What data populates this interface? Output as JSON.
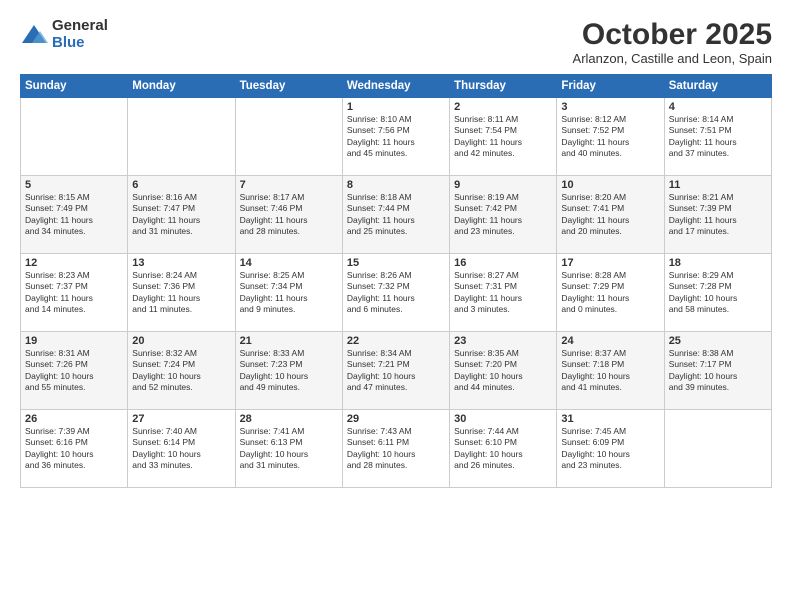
{
  "logo": {
    "general": "General",
    "blue": "Blue"
  },
  "header": {
    "month": "October 2025",
    "location": "Arlanzon, Castille and Leon, Spain"
  },
  "weekdays": [
    "Sunday",
    "Monday",
    "Tuesday",
    "Wednesday",
    "Thursday",
    "Friday",
    "Saturday"
  ],
  "weeks": [
    [
      {
        "day": "",
        "info": ""
      },
      {
        "day": "",
        "info": ""
      },
      {
        "day": "",
        "info": ""
      },
      {
        "day": "1",
        "info": "Sunrise: 8:10 AM\nSunset: 7:56 PM\nDaylight: 11 hours\nand 45 minutes."
      },
      {
        "day": "2",
        "info": "Sunrise: 8:11 AM\nSunset: 7:54 PM\nDaylight: 11 hours\nand 42 minutes."
      },
      {
        "day": "3",
        "info": "Sunrise: 8:12 AM\nSunset: 7:52 PM\nDaylight: 11 hours\nand 40 minutes."
      },
      {
        "day": "4",
        "info": "Sunrise: 8:14 AM\nSunset: 7:51 PM\nDaylight: 11 hours\nand 37 minutes."
      }
    ],
    [
      {
        "day": "5",
        "info": "Sunrise: 8:15 AM\nSunset: 7:49 PM\nDaylight: 11 hours\nand 34 minutes."
      },
      {
        "day": "6",
        "info": "Sunrise: 8:16 AM\nSunset: 7:47 PM\nDaylight: 11 hours\nand 31 minutes."
      },
      {
        "day": "7",
        "info": "Sunrise: 8:17 AM\nSunset: 7:46 PM\nDaylight: 11 hours\nand 28 minutes."
      },
      {
        "day": "8",
        "info": "Sunrise: 8:18 AM\nSunset: 7:44 PM\nDaylight: 11 hours\nand 25 minutes."
      },
      {
        "day": "9",
        "info": "Sunrise: 8:19 AM\nSunset: 7:42 PM\nDaylight: 11 hours\nand 23 minutes."
      },
      {
        "day": "10",
        "info": "Sunrise: 8:20 AM\nSunset: 7:41 PM\nDaylight: 11 hours\nand 20 minutes."
      },
      {
        "day": "11",
        "info": "Sunrise: 8:21 AM\nSunset: 7:39 PM\nDaylight: 11 hours\nand 17 minutes."
      }
    ],
    [
      {
        "day": "12",
        "info": "Sunrise: 8:23 AM\nSunset: 7:37 PM\nDaylight: 11 hours\nand 14 minutes."
      },
      {
        "day": "13",
        "info": "Sunrise: 8:24 AM\nSunset: 7:36 PM\nDaylight: 11 hours\nand 11 minutes."
      },
      {
        "day": "14",
        "info": "Sunrise: 8:25 AM\nSunset: 7:34 PM\nDaylight: 11 hours\nand 9 minutes."
      },
      {
        "day": "15",
        "info": "Sunrise: 8:26 AM\nSunset: 7:32 PM\nDaylight: 11 hours\nand 6 minutes."
      },
      {
        "day": "16",
        "info": "Sunrise: 8:27 AM\nSunset: 7:31 PM\nDaylight: 11 hours\nand 3 minutes."
      },
      {
        "day": "17",
        "info": "Sunrise: 8:28 AM\nSunset: 7:29 PM\nDaylight: 11 hours\nand 0 minutes."
      },
      {
        "day": "18",
        "info": "Sunrise: 8:29 AM\nSunset: 7:28 PM\nDaylight: 10 hours\nand 58 minutes."
      }
    ],
    [
      {
        "day": "19",
        "info": "Sunrise: 8:31 AM\nSunset: 7:26 PM\nDaylight: 10 hours\nand 55 minutes."
      },
      {
        "day": "20",
        "info": "Sunrise: 8:32 AM\nSunset: 7:24 PM\nDaylight: 10 hours\nand 52 minutes."
      },
      {
        "day": "21",
        "info": "Sunrise: 8:33 AM\nSunset: 7:23 PM\nDaylight: 10 hours\nand 49 minutes."
      },
      {
        "day": "22",
        "info": "Sunrise: 8:34 AM\nSunset: 7:21 PM\nDaylight: 10 hours\nand 47 minutes."
      },
      {
        "day": "23",
        "info": "Sunrise: 8:35 AM\nSunset: 7:20 PM\nDaylight: 10 hours\nand 44 minutes."
      },
      {
        "day": "24",
        "info": "Sunrise: 8:37 AM\nSunset: 7:18 PM\nDaylight: 10 hours\nand 41 minutes."
      },
      {
        "day": "25",
        "info": "Sunrise: 8:38 AM\nSunset: 7:17 PM\nDaylight: 10 hours\nand 39 minutes."
      }
    ],
    [
      {
        "day": "26",
        "info": "Sunrise: 7:39 AM\nSunset: 6:16 PM\nDaylight: 10 hours\nand 36 minutes."
      },
      {
        "day": "27",
        "info": "Sunrise: 7:40 AM\nSunset: 6:14 PM\nDaylight: 10 hours\nand 33 minutes."
      },
      {
        "day": "28",
        "info": "Sunrise: 7:41 AM\nSunset: 6:13 PM\nDaylight: 10 hours\nand 31 minutes."
      },
      {
        "day": "29",
        "info": "Sunrise: 7:43 AM\nSunset: 6:11 PM\nDaylight: 10 hours\nand 28 minutes."
      },
      {
        "day": "30",
        "info": "Sunrise: 7:44 AM\nSunset: 6:10 PM\nDaylight: 10 hours\nand 26 minutes."
      },
      {
        "day": "31",
        "info": "Sunrise: 7:45 AM\nSunset: 6:09 PM\nDaylight: 10 hours\nand 23 minutes."
      },
      {
        "day": "",
        "info": ""
      }
    ]
  ]
}
